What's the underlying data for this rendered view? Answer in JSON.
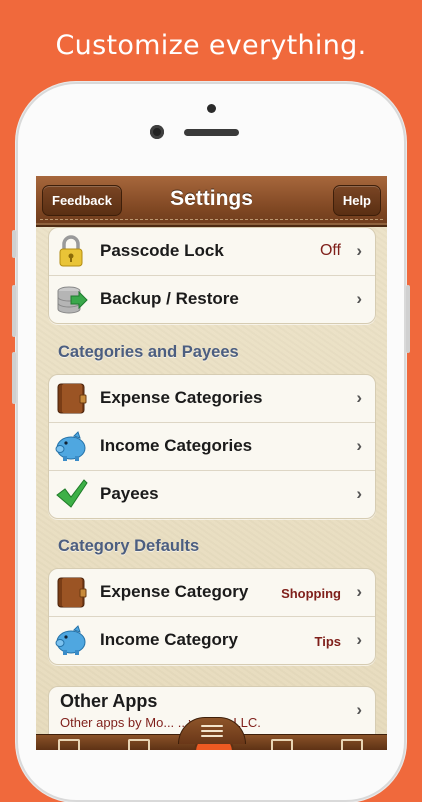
{
  "promo": {
    "tagline": "Customize everything."
  },
  "nav": {
    "title": "Settings",
    "left_button": "Feedback",
    "right_button": "Help"
  },
  "group1": [
    {
      "label": "Passcode Lock",
      "value": "Off",
      "icon": "padlock-icon"
    },
    {
      "label": "Backup / Restore",
      "value": "",
      "icon": "database-backup-icon"
    }
  ],
  "section_categories": {
    "header": "Categories and Payees",
    "items": [
      {
        "label": "Expense Categories",
        "icon": "wallet-icon"
      },
      {
        "label": "Income Categories",
        "icon": "piggy-bank-icon"
      },
      {
        "label": "Payees",
        "icon": "checkmark-icon"
      }
    ]
  },
  "section_defaults": {
    "header": "Category Defaults",
    "items": [
      {
        "label": "Expense Category",
        "value": "Shopping",
        "icon": "wallet-icon"
      },
      {
        "label": "Income Category",
        "value": "Tips",
        "icon": "piggy-bank-icon"
      }
    ]
  },
  "other_apps": {
    "title": "Other Apps",
    "subtitle": "Other apps by Mo... ...vations LLC."
  },
  "chevron": "›",
  "colors": {
    "background": "#f0693c",
    "leather": "#7e4622",
    "section_header": "#4c5e80",
    "value_text": "#7f1f1a"
  }
}
